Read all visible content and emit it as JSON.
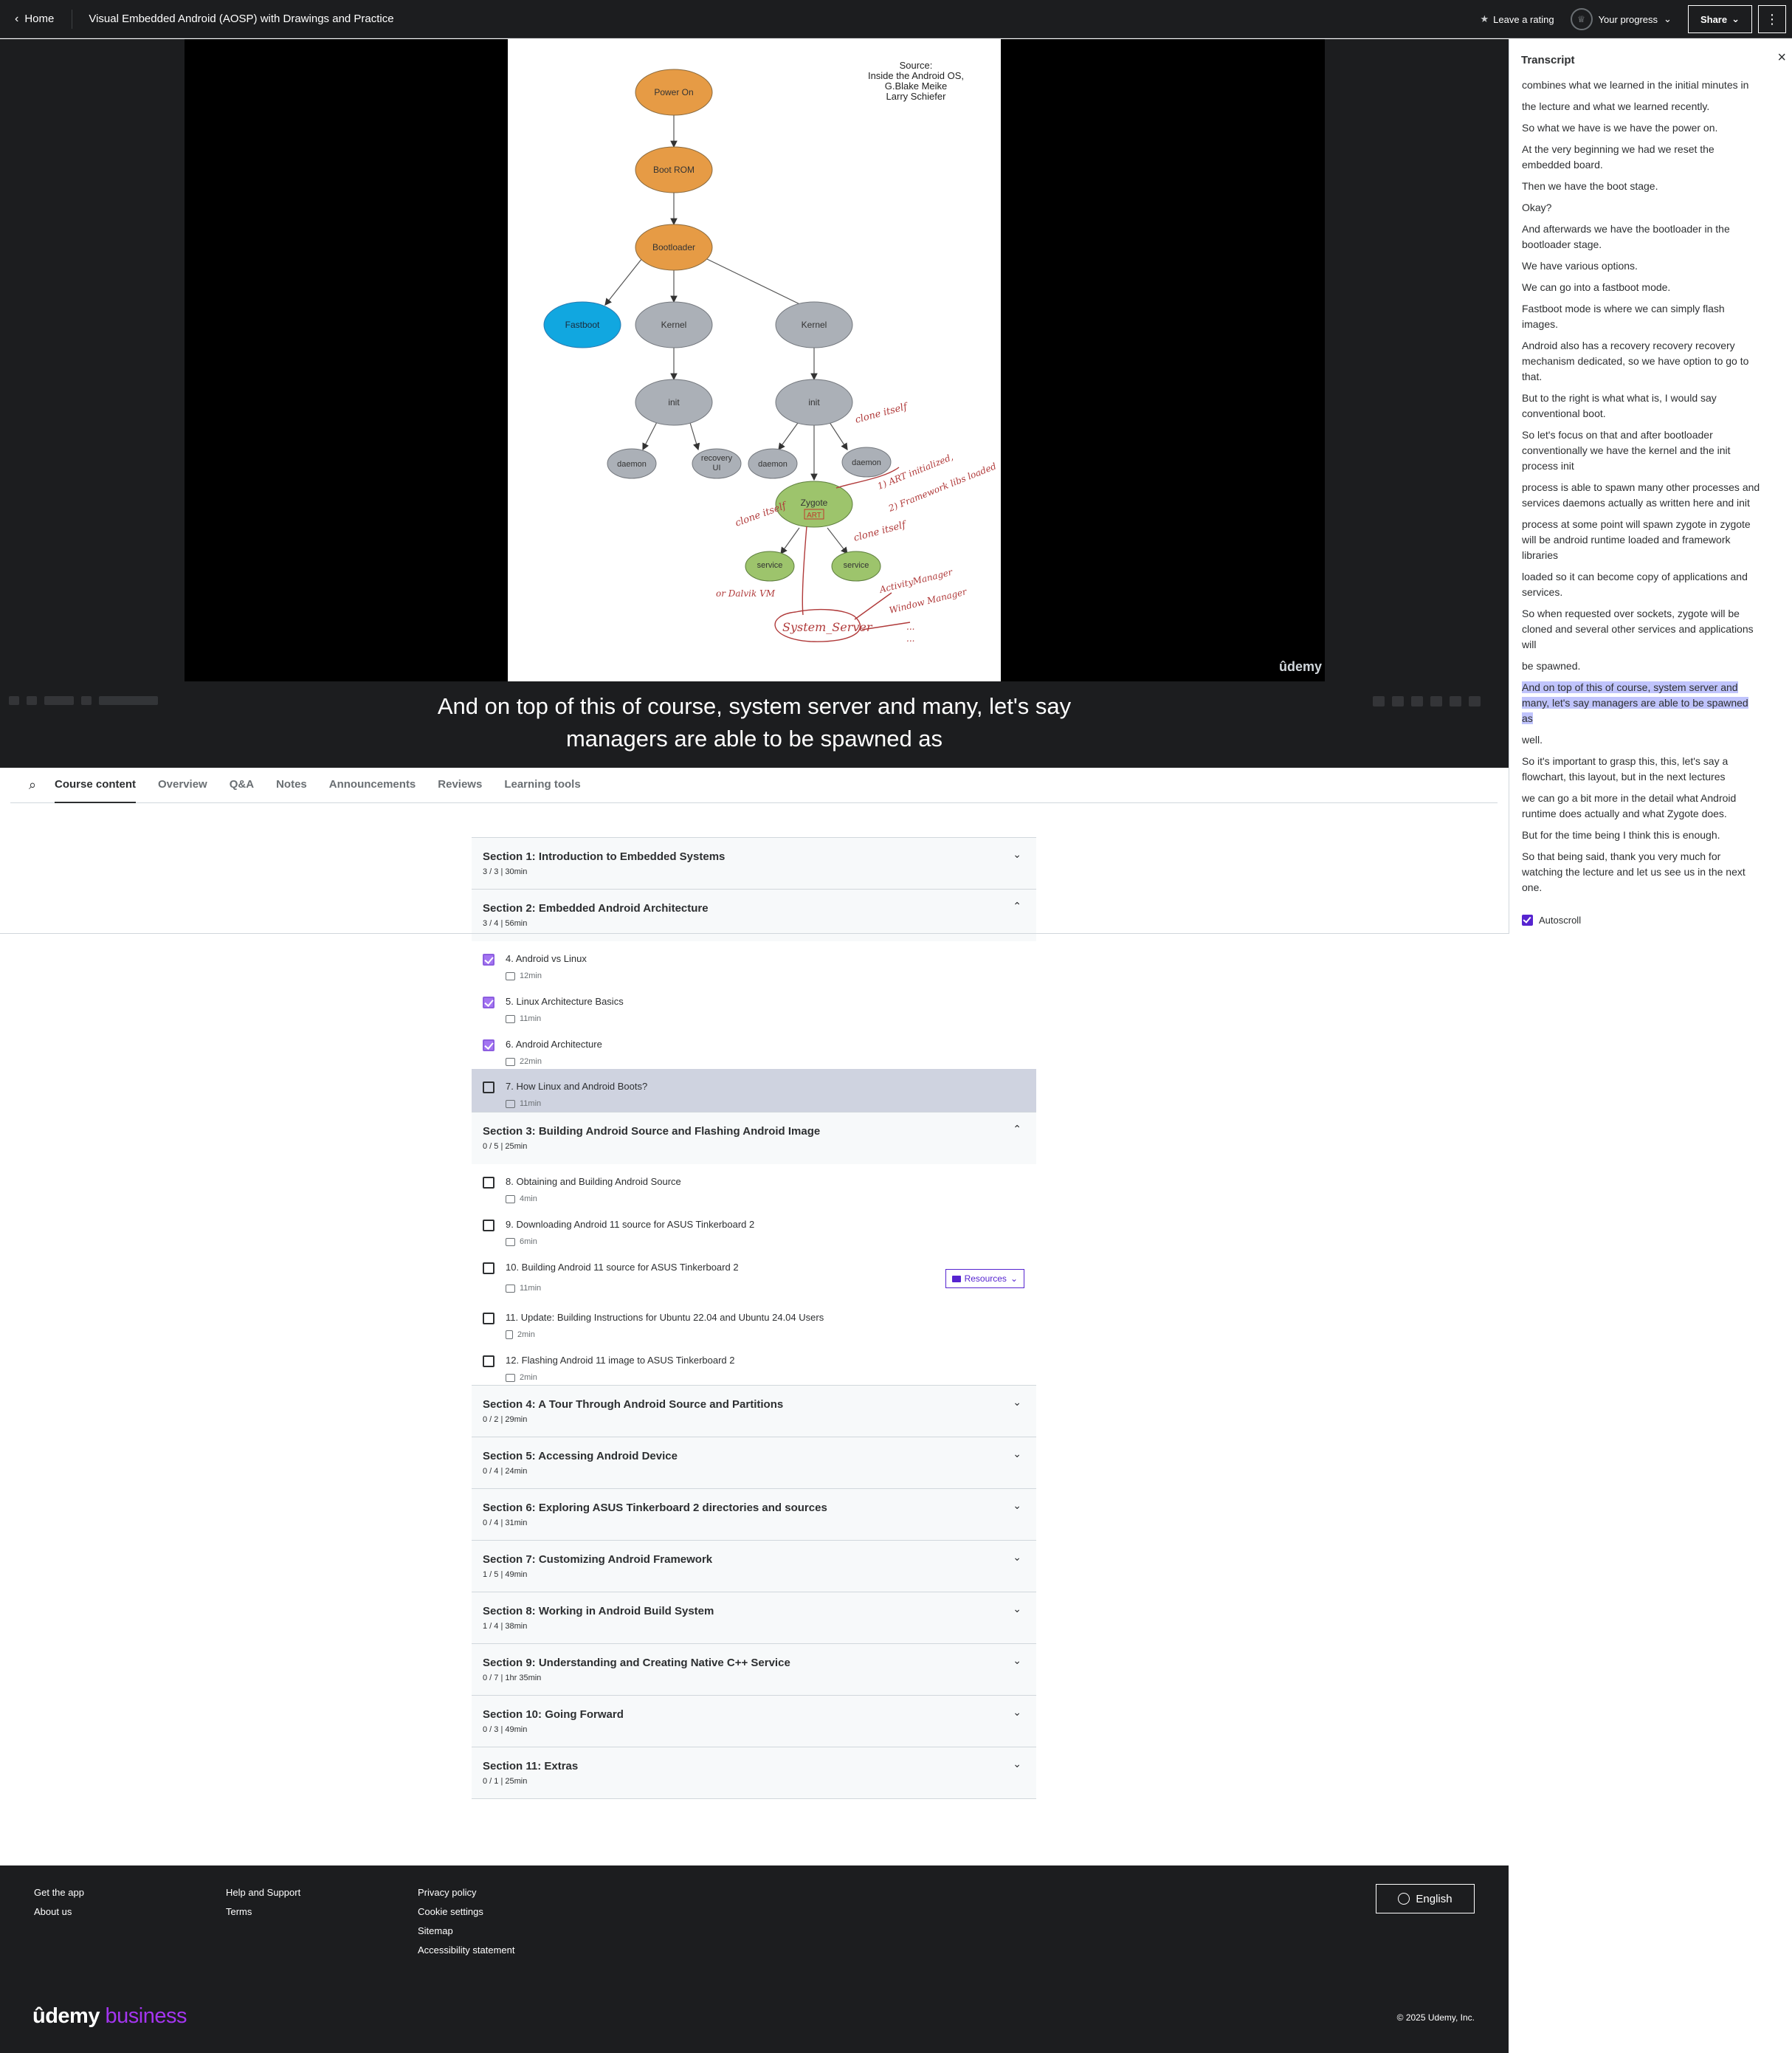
{
  "header": {
    "home_label": "Home",
    "course_title": "Visual Embedded Android (AOSP) with Drawings and Practice",
    "rating_label": "Leave a rating",
    "progress_label": "Your progress",
    "share_label": "Share"
  },
  "slide": {
    "source": [
      "Source:",
      "Inside the Android OS,",
      "G.Blake Meike",
      "Larry Schiefer"
    ],
    "nodes": {
      "power_on": "Power On",
      "boot_rom": "Boot ROM",
      "bootloader": "Bootloader",
      "fastboot": "Fastboot",
      "kernel": "Kernel",
      "init": "init",
      "daemon": "daemon",
      "recovery_1": "recovery",
      "recovery_2": "UI",
      "zygote": "Zygote",
      "art": "ART",
      "service": "service",
      "system_server": "System_Server"
    },
    "notes": {
      "clone_itself": "clone itself",
      "art_initialized": "1) ART initialized,",
      "framework_libs": "2) Framework libs loaded",
      "or_dalvik": "or Dalvik VM",
      "activity_manager": "ActivityManager",
      "window_manager": "Window Manager"
    },
    "watermark": "ûdemy"
  },
  "caption": {
    "line1": "And on top of this of course, system server and many, let's say",
    "line2": "managers are able to be spawned as"
  },
  "tabs": [
    {
      "label": "Course content"
    },
    {
      "label": "Overview"
    },
    {
      "label": "Q&A"
    },
    {
      "label": "Notes"
    },
    {
      "label": "Announcements"
    },
    {
      "label": "Reviews"
    },
    {
      "label": "Learning tools"
    }
  ],
  "sections": [
    {
      "title": "Section 1: Introduction to Embedded Systems",
      "meta": "3 / 3 | 30min",
      "expanded": false
    },
    {
      "title": "Section 2: Embedded Android Architecture",
      "meta": "3 / 4 | 56min",
      "expanded": true
    },
    {
      "title": "Section 3: Building Android Source and Flashing Android Image",
      "meta": "0 / 5 | 25min",
      "expanded": true
    },
    {
      "title": "Section 4: A Tour Through Android Source and Partitions",
      "meta": "0 / 2 | 29min",
      "expanded": false
    },
    {
      "title": "Section 5: Accessing Android Device",
      "meta": "0 / 4 | 24min",
      "expanded": false
    },
    {
      "title": "Section 6: Exploring ASUS Tinkerboard 2 directories and sources",
      "meta": "0 / 4 | 31min",
      "expanded": false
    },
    {
      "title": "Section 7: Customizing Android Framework",
      "meta": "1 / 5 | 49min",
      "expanded": false
    },
    {
      "title": "Section 8: Working in Android Build System",
      "meta": "1 / 4 | 38min",
      "expanded": false
    },
    {
      "title": "Section 9: Understanding and Creating Native C++ Service",
      "meta": "0 / 7 | 1hr 35min",
      "expanded": false
    },
    {
      "title": "Section 10: Going Forward",
      "meta": "0 / 3 | 49min",
      "expanded": false
    },
    {
      "title": "Section 11: Extras",
      "meta": "0 / 1 | 25min",
      "expanded": false
    }
  ],
  "lectures": [
    {
      "title": "4. Android vs Linux",
      "duration": "12min",
      "done": true
    },
    {
      "title": "5. Linux Architecture Basics",
      "duration": "11min",
      "done": true
    },
    {
      "title": "6. Android Architecture",
      "duration": "22min",
      "done": true
    },
    {
      "title": "7. How Linux and Android Boots?",
      "duration": "11min",
      "done": false,
      "current": true
    },
    {
      "title": "8. Obtaining and Building Android Source",
      "duration": "4min",
      "done": false
    },
    {
      "title": "9. Downloading Android 11 source for ASUS Tinkerboard 2",
      "duration": "6min",
      "done": false
    },
    {
      "title": "10. Building Android 11 source for ASUS Tinkerboard 2",
      "duration": "11min",
      "done": false,
      "resources": "Resources"
    },
    {
      "title": "11. Update: Building Instructions for Ubuntu 22.04 and Ubuntu 24.04 Users",
      "duration": "2min",
      "done": false
    },
    {
      "title": "12. Flashing Android 11 image to ASUS Tinkerboard 2",
      "duration": "2min",
      "done": false
    }
  ],
  "transcript": {
    "title": "Transcript",
    "autoscroll": "Autoscroll",
    "lines": [
      [
        "combines what we learned in the initial minutes in"
      ],
      [
        "the lecture and what we learned recently."
      ],
      [
        "So what we have is we have the power on."
      ],
      [
        "At the very beginning we had we reset the",
        "embedded board."
      ],
      [
        "Then we have the boot stage."
      ],
      [
        "Okay?"
      ],
      [
        "And afterwards we have the bootloader in the",
        "bootloader stage."
      ],
      [
        "We have various options."
      ],
      [
        "We can go into a fastboot mode."
      ],
      [
        "Fastboot mode is where we can simply flash",
        "images."
      ],
      [
        "Android also has a recovery recovery recovery",
        "mechanism dedicated, so we have option to go to",
        "that."
      ],
      [
        "But to the right is what what is, I would say",
        "conventional boot."
      ],
      [
        "So let's focus on that and after bootloader",
        "conventionally we have the kernel and the init",
        "process init"
      ],
      [
        "process is able to spawn many other processes and",
        "services daemons actually as written here and init"
      ],
      [
        "process at some point will spawn zygote in zygote",
        "will be android runtime loaded and framework",
        "libraries"
      ],
      [
        "loaded so it can become copy of applications and",
        "services."
      ],
      [
        "So when requested over sockets, zygote will be",
        "cloned and several other services and applications",
        "will"
      ],
      [
        "be spawned."
      ],
      [
        "And on top of this of course, system server and",
        "many, let's say managers are able to be spawned",
        "as"
      ],
      [
        "well."
      ],
      [
        "So it's important to grasp this, this, let's say a",
        "flowchart, this layout, but in the next lectures"
      ],
      [
        "we can go a bit more in the detail what Android",
        "runtime does actually and what Zygote does."
      ],
      [
        "But for the time being I think this is enough."
      ],
      [
        "So that being said, thank you very much for",
        "watching the lecture and let us see us in the next",
        "one."
      ]
    ],
    "highlight_index": 18
  },
  "footer": {
    "links": [
      "Get the app",
      "About us",
      "Help and Support",
      "Terms",
      "Privacy policy",
      "Cookie settings",
      "Sitemap",
      "Accessibility statement"
    ],
    "language": "English",
    "logo_main": "ûdemy",
    "logo_sub": "business",
    "copyright": "© 2025 Udemy, Inc."
  }
}
